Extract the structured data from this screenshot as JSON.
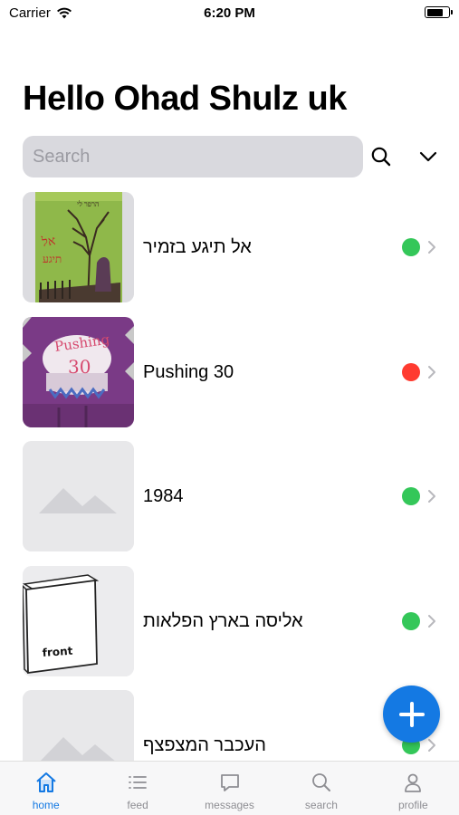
{
  "status_bar": {
    "carrier": "Carrier",
    "time": "6:20 PM"
  },
  "header": {
    "title": "Hello Ohad Shulz uk"
  },
  "search": {
    "placeholder": "Search",
    "value": ""
  },
  "books": [
    {
      "title": "אל תיגע בזמיר",
      "status": "available",
      "status_color": "#34c759",
      "cover": "cover-green-tree"
    },
    {
      "title": "Pushing 30",
      "status": "unavailable",
      "status_color": "#ff3b30",
      "cover": "cover-purple-cake"
    },
    {
      "title": "1984",
      "status": "available",
      "status_color": "#34c759",
      "cover": "placeholder"
    },
    {
      "title": "אליסה בארץ הפלאות",
      "status": "available",
      "status_color": "#34c759",
      "cover": "cover-sketch-front"
    },
    {
      "title": "העכבר המצפצף",
      "status": "available",
      "status_color": "#34c759",
      "cover": "placeholder"
    }
  ],
  "covers": {
    "sketch_text": "front"
  },
  "tabs": [
    {
      "label": "home",
      "icon": "home-icon",
      "active": true
    },
    {
      "label": "feed",
      "icon": "list-icon",
      "active": false
    },
    {
      "label": "messages",
      "icon": "chat-icon",
      "active": false
    },
    {
      "label": "search",
      "icon": "search-icon",
      "active": false
    },
    {
      "label": "profile",
      "icon": "person-icon",
      "active": false
    }
  ],
  "colors": {
    "accent": "#1479e3",
    "available": "#34c759",
    "unavailable": "#ff3b30",
    "inactive_tab": "#8e8e93"
  }
}
